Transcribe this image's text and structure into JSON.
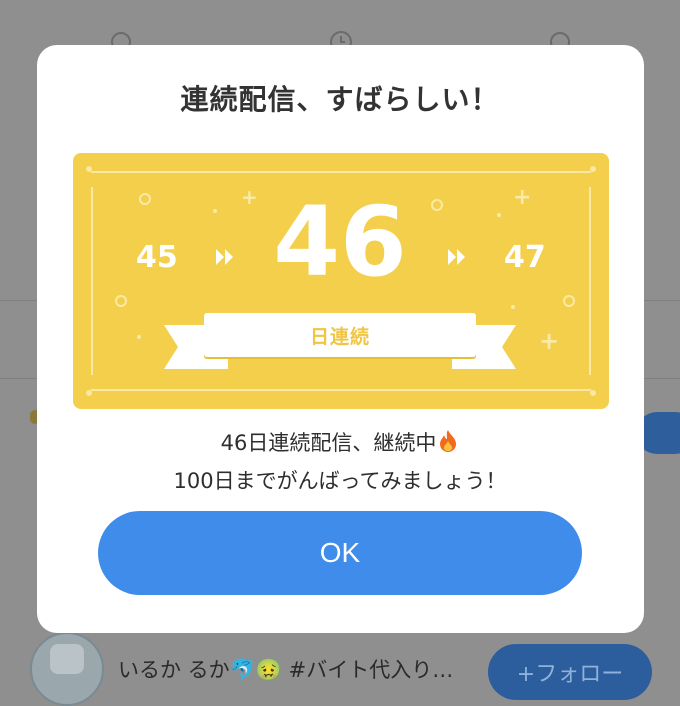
{
  "background": {
    "user_line": "いるか るか🐬🤢 #バイト代入り…",
    "follow_label": "+フォロー"
  },
  "modal": {
    "title": "連続配信、すばらしい！",
    "streak": {
      "previous": "45",
      "current": "46",
      "next": "47",
      "ribbon_label": "日連続"
    },
    "message_line1": "46日連続配信、継続中",
    "message_line2": "100日までがんばってみましょう！",
    "ok_label": "OK"
  },
  "colors": {
    "banner": "#f3cf4b",
    "button": "#3f8ceb",
    "overlay": "#8f8f8f"
  },
  "icons": [
    "fire-icon",
    "double-chevron-right-icon"
  ]
}
